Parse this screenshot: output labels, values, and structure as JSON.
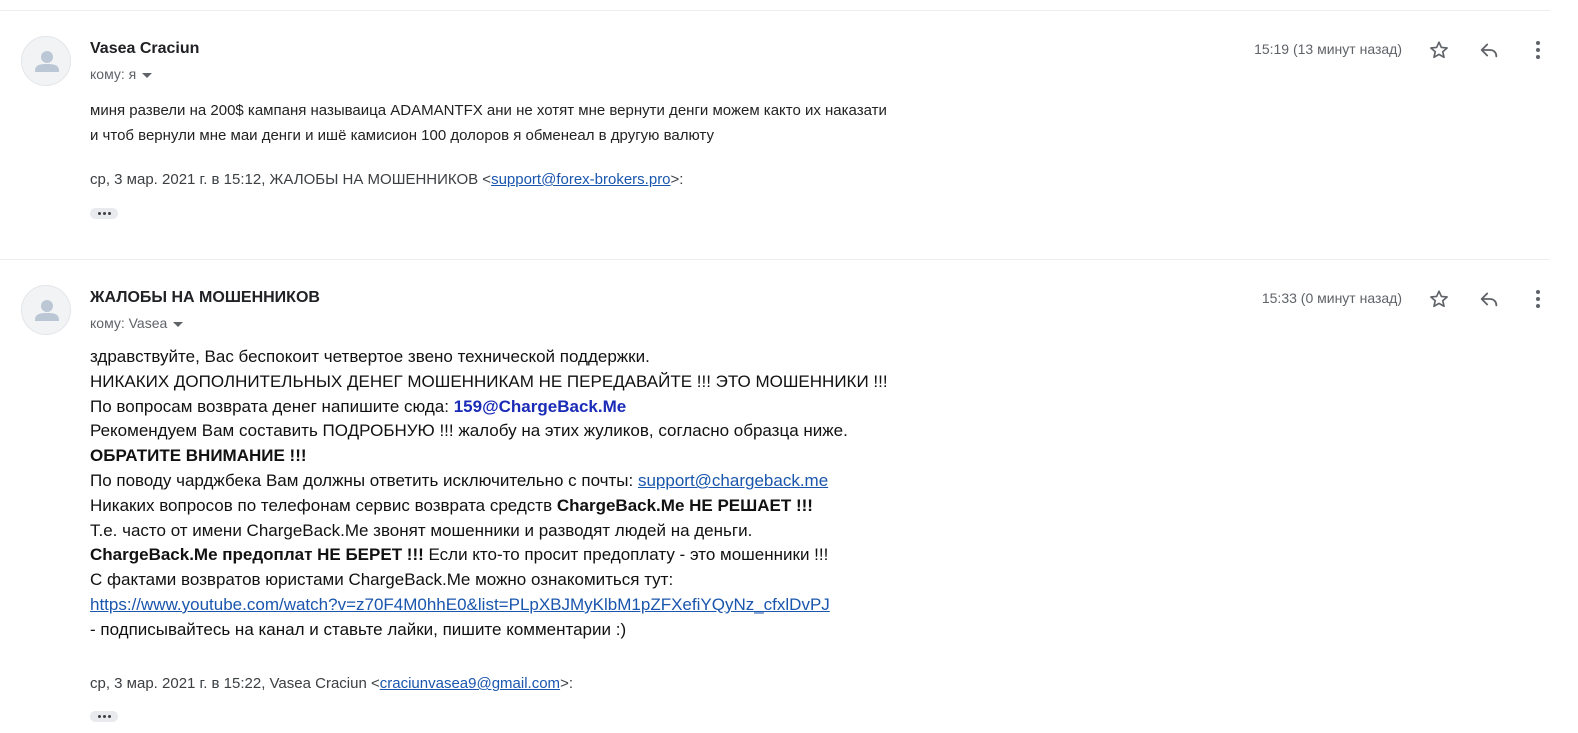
{
  "messages": [
    {
      "sender": "Vasea Craciun",
      "recipient": "кому: я",
      "time": "15:19 (13 минут назад)",
      "body": [
        "миня развели на 200$ кампаня называица ADAMANTFX  ани не хотят мне вернути денги можем както их наказати",
        "и чтоб вернули мне маи денги и ишё камисион 100 долоров я обменеал в другую валюту"
      ],
      "quote": {
        "prefix": "ср, 3 мар. 2021 г. в 15:12, ЖАЛОБЫ НА МОШЕННИКОВ <",
        "email": "support@forex-brokers.pro",
        "suffix": ">:"
      }
    },
    {
      "sender": "ЖАЛОБЫ НА МОШЕННИКОВ",
      "recipient": "кому: Vasea",
      "time": "15:33 (0 минут назад)",
      "body": {
        "l1": "здравствуйте, Вас беспокоит четвертое звено технической поддержки.",
        "l2": "НИКАКИХ ДОПОЛНИТЕЛЬНЫХ ДЕНЕГ МОШЕННИКАМ НЕ ПЕРЕДАВАЙТЕ !!! ЭТО МОШЕННИКИ !!!",
        "l3_text": "По вопросам возврата денег напишите сюда: ",
        "l3_email": "159@ChargeBack.Me",
        "l4": "Рекомендуем Вам составить ПОДРОБНУЮ !!! жалобу на этих жуликов, согласно образца ниже.",
        "l5": "ОБРАТИТЕ ВНИМАНИЕ !!!",
        "l6_text": "По поводу чарджбека Вам должны ответить исключительно с почты: ",
        "l6_email": "support@chargeback.me",
        "l7_text": "Никаких вопросов по телефонам сервис возврата средств ",
        "l7_bold": "ChargeBack.Me НЕ РЕШАЕТ !!!",
        "l8": "Т.е. часто от имени ChargeBack.Me звонят мошенники и разводят людей на деньги.",
        "l9_bold": "ChargeBack.Me предоплат НЕ БЕРЕТ !!!",
        "l9_text": " Если кто-то просит предоплату - это мошенники !!!",
        "l10": "С фактами возвратов юристами ChargeBack.Me можно ознакомиться тут:",
        "l11_link": "https://www.youtube.com/watch?v=z70F4M0hhE0&list=PLpXBJMyKlbM1pZFXefiYQyNz_cfxlDvPJ",
        "l12": " - подписывайтесь на канал и ставьте лайки, пишите комментарии :)"
      },
      "quote": {
        "prefix": "ср, 3 мар. 2021 г. в 15:22, Vasea Craciun <",
        "email": "craciunvasea9@gmail.com",
        "suffix": ">:"
      }
    }
  ],
  "icons": {
    "avatar": "person-icon",
    "star": "star-icon",
    "reply": "reply-icon",
    "more": "more-vert-icon",
    "show_trimmed": "ellipsis-icon"
  },
  "colors": {
    "link": "#1a56ad",
    "highlight_email": "#1a2bb8",
    "meta_text": "#5f6368"
  }
}
